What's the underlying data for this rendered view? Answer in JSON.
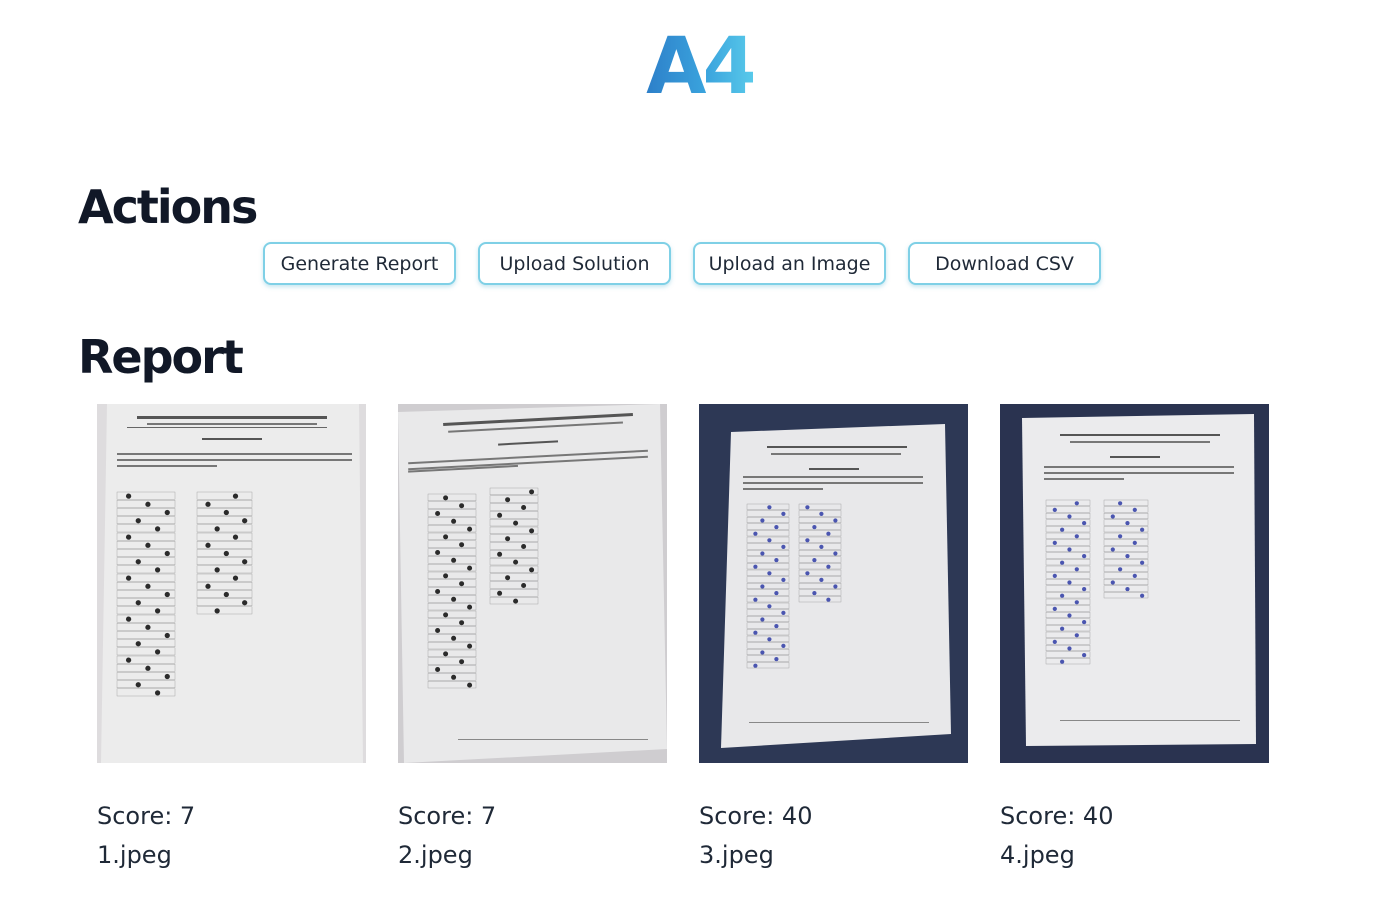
{
  "logo": "A4",
  "actions": {
    "title": "Actions",
    "buttons": [
      "Generate Report",
      "Upload Solution",
      "Upload an Image",
      "Download CSV"
    ]
  },
  "report": {
    "title": "Report",
    "items": [
      {
        "score_text": "Score: 7",
        "filename": "1.jpeg",
        "background": "#c9c6c9"
      },
      {
        "score_text": "Score: 7",
        "filename": "2.jpeg",
        "background": "#cfcdd0"
      },
      {
        "score_text": "Score: 40",
        "filename": "3.jpeg",
        "background": "#2b3552"
      },
      {
        "score_text": "Score: 40",
        "filename": "4.jpeg",
        "background": "#2a3350"
      }
    ]
  },
  "colors": {
    "logo_start": "#2d7fc9",
    "logo_end": "#58c9ea",
    "button_border": "#7fd0e6"
  }
}
